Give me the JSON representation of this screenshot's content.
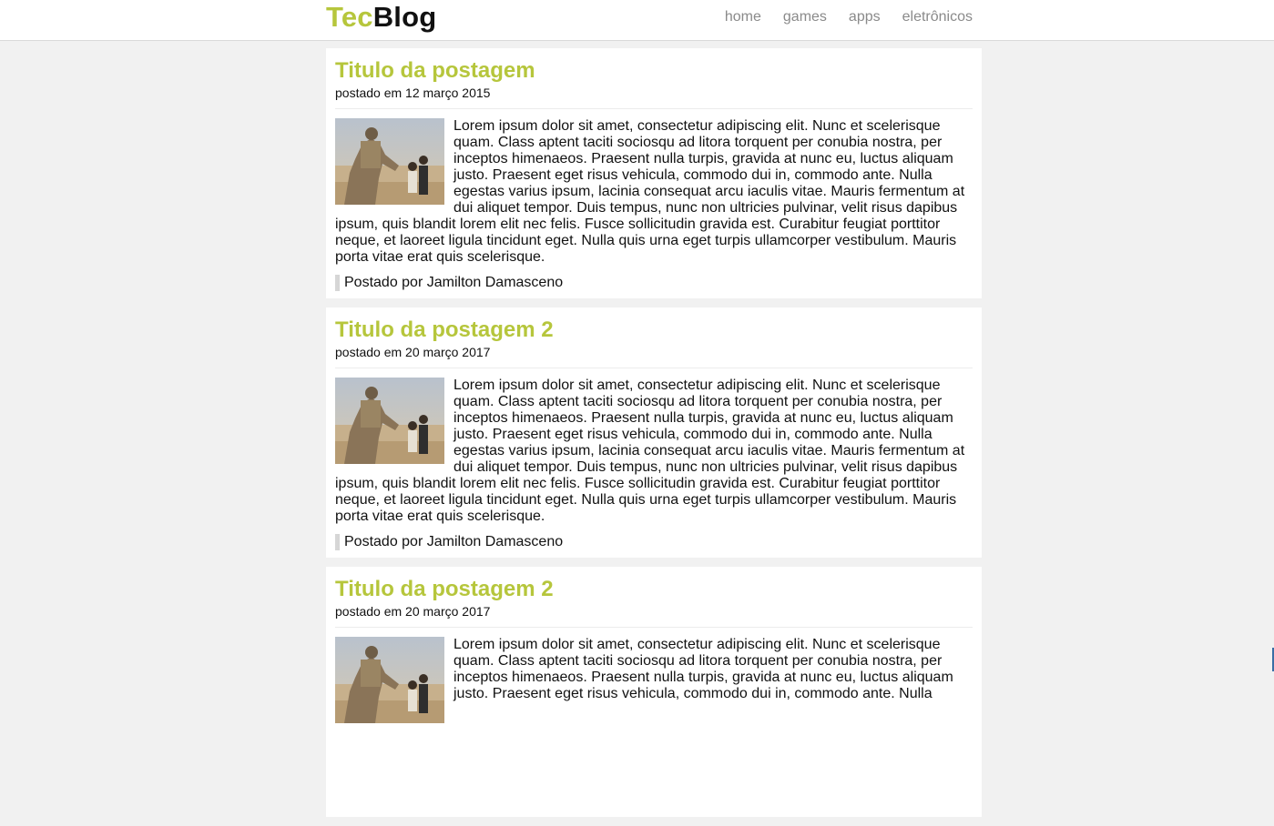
{
  "brand": {
    "part1": "Tec",
    "part2": "Blog",
    "accent_color": "#b6c63c"
  },
  "nav": {
    "items": [
      "home",
      "games",
      "apps",
      "eletrônicos"
    ]
  },
  "posts": [
    {
      "title": "Titulo da postagem",
      "date": "postado em 12 março 2015",
      "image": "soldier-with-child-thumbnail",
      "body": "Lorem ipsum dolor sit amet, consectetur adipiscing elit. Nunc et scelerisque quam. Class aptent taciti sociosqu ad litora torquent per conubia nostra, per inceptos himenaeos. Praesent nulla turpis, gravida at nunc eu, luctus aliquam justo. Praesent eget risus vehicula, commodo dui in, commodo ante. Nulla egestas varius ipsum, lacinia consequat arcu iaculis vitae. Mauris fermentum at dui aliquet tempor. Duis tempus, nunc non ultricies pulvinar, velit risus dapibus ipsum, quis blandit lorem elit nec felis. Fusce sollicitudin gravida est. Curabitur feugiat porttitor neque, et laoreet ligula tincidunt eget. Nulla quis urna eget turpis ullamcorper vestibulum. Mauris porta vitae erat quis scelerisque.",
      "author": "Postado por Jamilton Damasceno"
    },
    {
      "title": "Titulo da postagem 2",
      "date": "postado em 20 março 2017",
      "image": "soldier-with-child-thumbnail",
      "body": "Lorem ipsum dolor sit amet, consectetur adipiscing elit. Nunc et scelerisque quam. Class aptent taciti sociosqu ad litora torquent per conubia nostra, per inceptos himenaeos. Praesent nulla turpis, gravida at nunc eu, luctus aliquam justo. Praesent eget risus vehicula, commodo dui in, commodo ante. Nulla egestas varius ipsum, lacinia consequat arcu iaculis vitae. Mauris fermentum at dui aliquet tempor. Duis tempus, nunc non ultricies pulvinar, velit risus dapibus ipsum, quis blandit lorem elit nec felis. Fusce sollicitudin gravida est. Curabitur feugiat porttitor neque, et laoreet ligula tincidunt eget. Nulla quis urna eget turpis ullamcorper vestibulum. Mauris porta vitae erat quis scelerisque.",
      "author": "Postado por Jamilton Damasceno"
    },
    {
      "title": "Titulo da postagem 2",
      "date": "postado em 20 março 2017",
      "image": "soldier-with-child-thumbnail",
      "body": "Lorem ipsum dolor sit amet, consectetur adipiscing elit. Nunc et scelerisque quam. Class aptent taciti sociosqu ad litora torquent per conubia nostra, per inceptos himenaeos. Praesent nulla turpis, gravida at nunc eu, luctus aliquam justo. Praesent eget risus vehicula, commodo dui in, commodo ante. Nulla",
      "author": ""
    }
  ]
}
